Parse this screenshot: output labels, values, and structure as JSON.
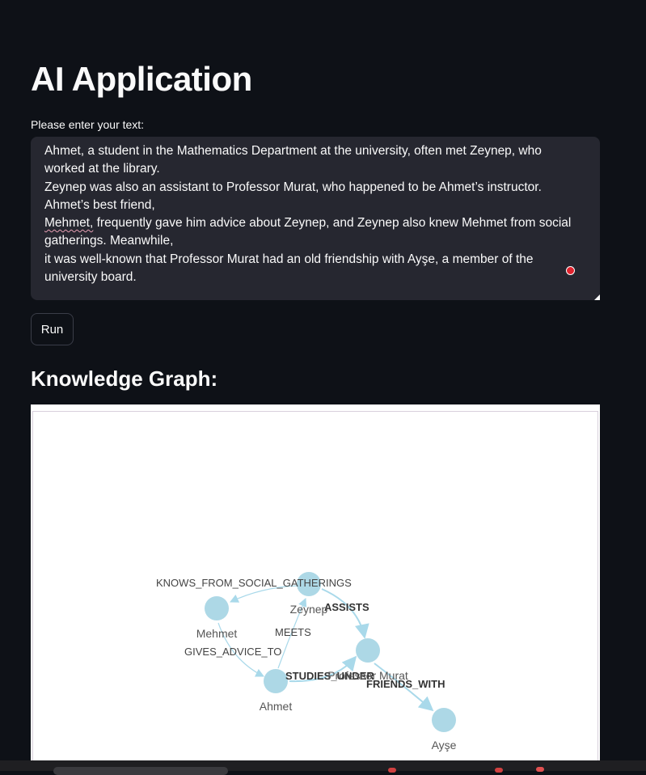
{
  "app": {
    "title": "AI Application"
  },
  "input": {
    "label": "Please enter your text:",
    "lines": [
      "Ahmet, a student in the Mathematics Department at the university, often met Zeynep, who worked at the library.",
      "Zeynep was also an assistant to Professor Murat, who happened to be Ahmet’s instructor. Ahmet’s best friend,",
      "frequently gave him advice about Zeynep, and Zeynep also knew Mehmet from social gatherings. Meanwhile,",
      "it was well-known that Professor Murat had an old friendship with Ayşe, a member of the university board."
    ],
    "misspelled_word": "Mehmet,"
  },
  "actions": {
    "run_label": "Run"
  },
  "graph": {
    "section_title": "Knowledge Graph:",
    "node_color": "#add8e6",
    "edge_color": "#a9d9ea",
    "nodes": [
      {
        "id": "zeynep",
        "label": "Zeynep"
      },
      {
        "id": "mehmet",
        "label": "Mehmet"
      },
      {
        "id": "murat",
        "label": "Professor Murat"
      },
      {
        "id": "ahmet",
        "label": "Ahmet"
      },
      {
        "id": "ayse",
        "label": "Ayşe"
      }
    ],
    "edges": [
      {
        "from": "zeynep",
        "to": "mehmet",
        "label": "KNOWS_FROM_SOCIAL_GATHERINGS"
      },
      {
        "from": "zeynep",
        "to": "murat",
        "label": "ASSISTS"
      },
      {
        "from": "mehmet",
        "to": "ahmet",
        "label": "GIVES_ADVICE_TO"
      },
      {
        "from": "ahmet",
        "to": "zeynep",
        "label": "MEETS"
      },
      {
        "from": "ahmet",
        "to": "murat",
        "label": "STUDIES_UNDER"
      },
      {
        "from": "murat",
        "to": "ayse",
        "label": "FRIENDS_WITH"
      }
    ]
  }
}
